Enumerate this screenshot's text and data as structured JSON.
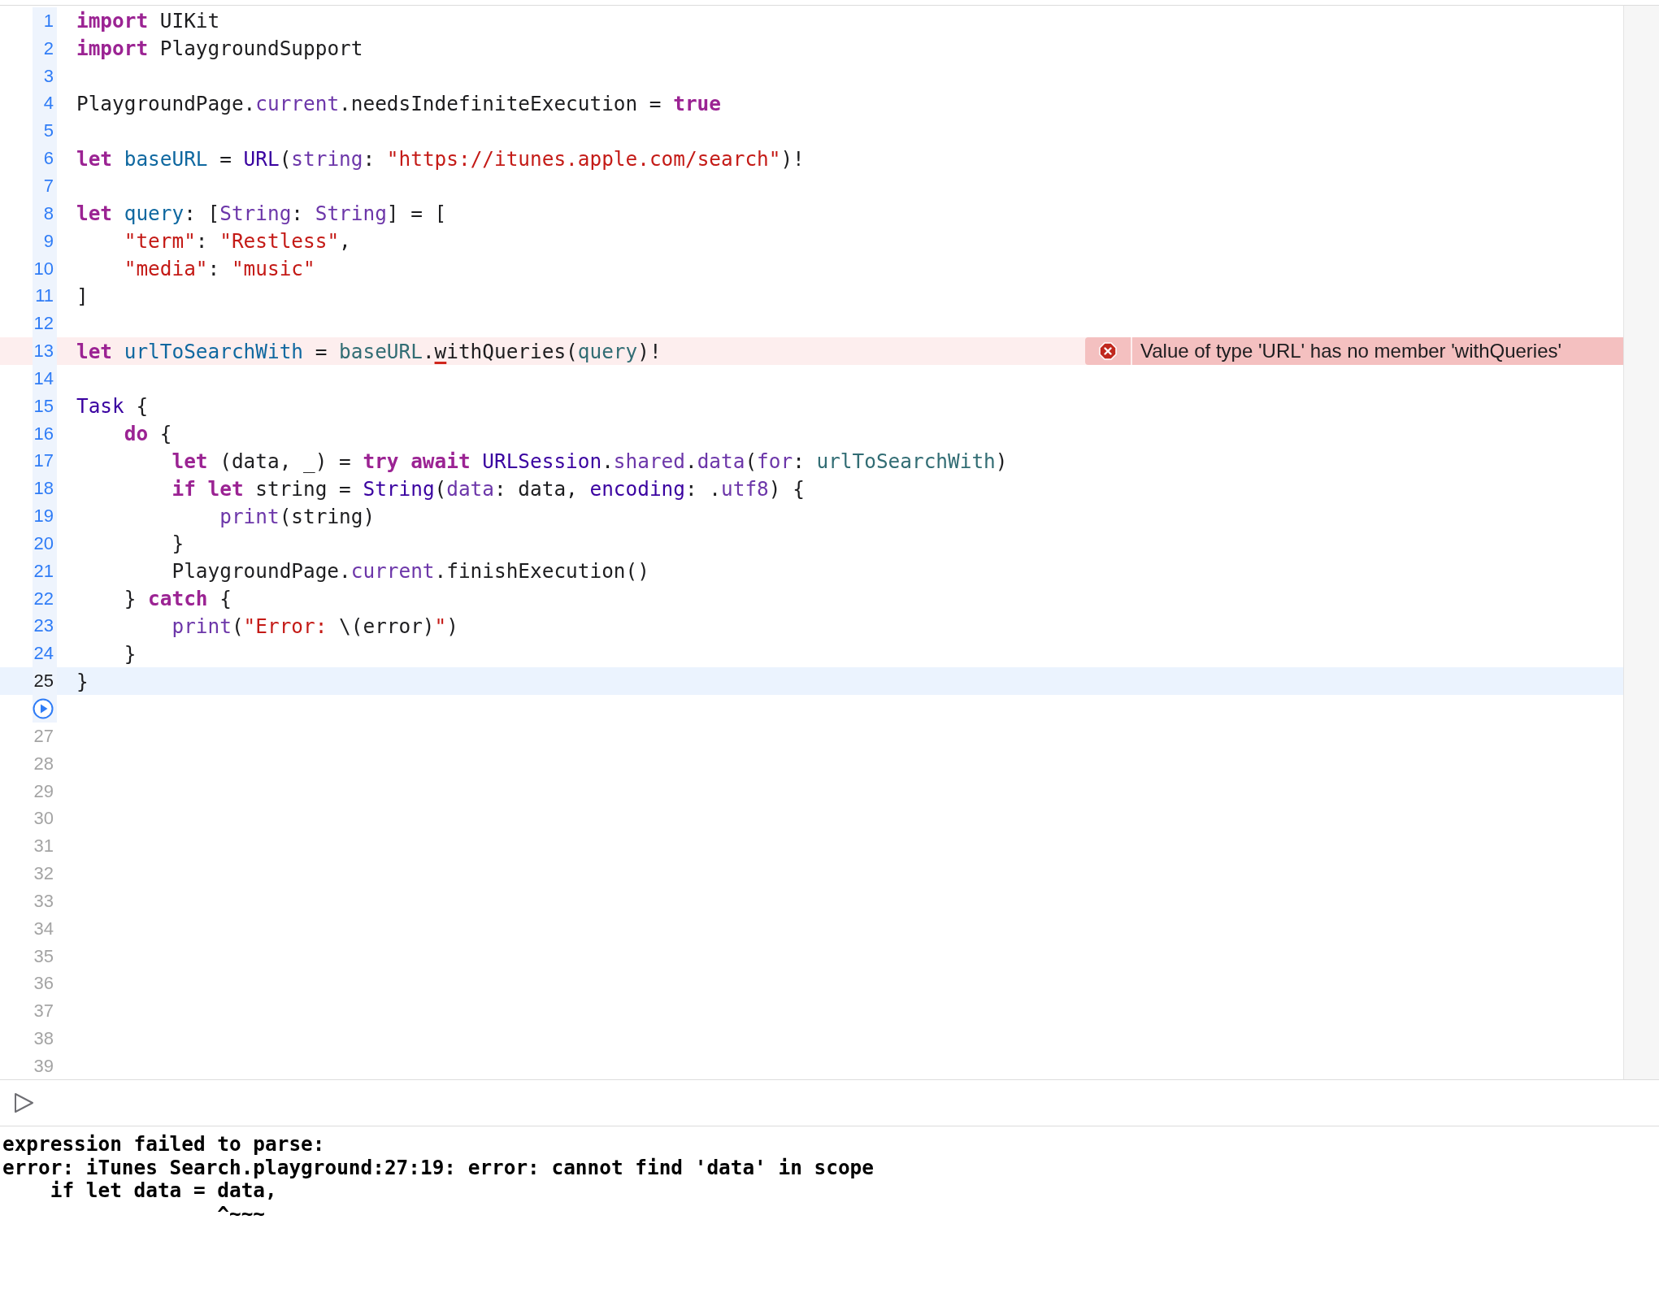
{
  "editor": {
    "lines": [
      {
        "number": "1",
        "kind": "code",
        "current": false,
        "tokens": [
          {
            "text": "import",
            "kind": "keyword"
          },
          {
            "text": " UIKit",
            "kind": "plain"
          }
        ]
      },
      {
        "number": "2",
        "kind": "code",
        "current": false,
        "tokens": [
          {
            "text": "import",
            "kind": "keyword"
          },
          {
            "text": " PlaygroundSupport",
            "kind": "plain"
          }
        ]
      },
      {
        "number": "3",
        "kind": "code",
        "current": false
      },
      {
        "number": "4",
        "kind": "code",
        "current": false,
        "tokens": [
          {
            "text": "PlaygroundPage.",
            "kind": "plain"
          },
          {
            "text": "current",
            "kind": "member"
          },
          {
            "text": ".needsIndefiniteExecution = ",
            "kind": "plain"
          },
          {
            "text": "true",
            "kind": "keyword"
          }
        ]
      },
      {
        "number": "5",
        "kind": "code",
        "current": false
      },
      {
        "number": "6",
        "kind": "code",
        "current": false,
        "tokens": [
          {
            "text": "let",
            "kind": "keyword"
          },
          {
            "text": " baseURL",
            "kind": "decl"
          },
          {
            "text": " = ",
            "kind": "plain"
          },
          {
            "text": "URL",
            "kind": "type"
          },
          {
            "text": "(",
            "kind": "plain"
          },
          {
            "text": "string",
            "kind": "member"
          },
          {
            "text": ": ",
            "kind": "plain"
          },
          {
            "text": "\"https://itunes.apple.com/search\"",
            "kind": "string"
          },
          {
            "text": ")!",
            "kind": "plain"
          }
        ]
      },
      {
        "number": "7",
        "kind": "code",
        "current": false
      },
      {
        "number": "8",
        "kind": "code",
        "current": false,
        "tokens": [
          {
            "text": "let",
            "kind": "keyword"
          },
          {
            "text": " query",
            "kind": "decl"
          },
          {
            "text": ": [",
            "kind": "plain"
          },
          {
            "text": "String",
            "kind": "member"
          },
          {
            "text": ": ",
            "kind": "plain"
          },
          {
            "text": "String",
            "kind": "member"
          },
          {
            "text": "] = [",
            "kind": "plain"
          }
        ]
      },
      {
        "number": "9",
        "kind": "code",
        "current": false,
        "tokens": [
          {
            "text": "    \"term\"",
            "kind": "string"
          },
          {
            "text": ": ",
            "kind": "plain"
          },
          {
            "text": "\"Restless\"",
            "kind": "string"
          },
          {
            "text": ",",
            "kind": "plain"
          }
        ]
      },
      {
        "number": "10",
        "kind": "code",
        "current": false,
        "tokens": [
          {
            "text": "    \"media\"",
            "kind": "string"
          },
          {
            "text": ": ",
            "kind": "plain"
          },
          {
            "text": "\"music\"",
            "kind": "string"
          }
        ]
      },
      {
        "number": "11",
        "kind": "code",
        "current": false,
        "tokens": [
          {
            "text": "]",
            "kind": "plain"
          }
        ]
      },
      {
        "number": "12",
        "kind": "code",
        "current": false
      },
      {
        "number": "13",
        "kind": "code",
        "current": false,
        "error": "Value of type 'URL' has no member 'withQueries'",
        "tokens": [
          {
            "text": "let",
            "kind": "keyword"
          },
          {
            "text": " urlToSearchWith",
            "kind": "decl"
          },
          {
            "text": " = ",
            "kind": "plain"
          },
          {
            "text": "baseURL",
            "kind": "project"
          },
          {
            "text": ".",
            "kind": "plain"
          },
          {
            "text": "w",
            "kind": "plain",
            "underlined": true
          },
          {
            "text": "ithQueries(",
            "kind": "plain"
          },
          {
            "text": "query",
            "kind": "project"
          },
          {
            "text": ")!",
            "kind": "plain"
          }
        ]
      },
      {
        "number": "14",
        "kind": "code",
        "current": false
      },
      {
        "number": "15",
        "kind": "code",
        "current": false,
        "tokens": [
          {
            "text": "Task",
            "kind": "type"
          },
          {
            "text": " {",
            "kind": "plain"
          }
        ]
      },
      {
        "number": "16",
        "kind": "code",
        "current": false,
        "tokens": [
          {
            "text": "    do",
            "kind": "keyword"
          },
          {
            "text": " {",
            "kind": "plain"
          }
        ]
      },
      {
        "number": "17",
        "kind": "code",
        "current": false,
        "tokens": [
          {
            "text": "        let",
            "kind": "keyword"
          },
          {
            "text": " (data, _) = ",
            "kind": "plain"
          },
          {
            "text": "try await",
            "kind": "keyword"
          },
          {
            "text": " URLSession",
            "kind": "type"
          },
          {
            "text": ".",
            "kind": "plain"
          },
          {
            "text": "shared",
            "kind": "member"
          },
          {
            "text": ".",
            "kind": "plain"
          },
          {
            "text": "data",
            "kind": "member"
          },
          {
            "text": "(",
            "kind": "plain"
          },
          {
            "text": "for",
            "kind": "member"
          },
          {
            "text": ": ",
            "kind": "plain"
          },
          {
            "text": "urlToSearchWith",
            "kind": "project"
          },
          {
            "text": ")",
            "kind": "plain"
          }
        ]
      },
      {
        "number": "18",
        "kind": "code",
        "current": false,
        "tokens": [
          {
            "text": "        if let",
            "kind": "keyword"
          },
          {
            "text": " string = ",
            "kind": "plain"
          },
          {
            "text": "String",
            "kind": "type"
          },
          {
            "text": "(",
            "kind": "plain"
          },
          {
            "text": "data",
            "kind": "member"
          },
          {
            "text": ": data, ",
            "kind": "plain"
          },
          {
            "text": "encoding",
            "kind": "type"
          },
          {
            "text": ": .",
            "kind": "plain"
          },
          {
            "text": "utf8",
            "kind": "member"
          },
          {
            "text": ") {",
            "kind": "plain"
          }
        ]
      },
      {
        "number": "19",
        "kind": "code",
        "current": false,
        "tokens": [
          {
            "text": "            print",
            "kind": "member"
          },
          {
            "text": "(string)",
            "kind": "plain"
          }
        ]
      },
      {
        "number": "20",
        "kind": "code",
        "current": false,
        "tokens": [
          {
            "text": "        }",
            "kind": "plain"
          }
        ]
      },
      {
        "number": "21",
        "kind": "code",
        "current": false,
        "tokens": [
          {
            "text": "        PlaygroundPage.",
            "kind": "plain"
          },
          {
            "text": "current",
            "kind": "member"
          },
          {
            "text": ".finishExecution()",
            "kind": "plain"
          }
        ]
      },
      {
        "number": "22",
        "kind": "code",
        "current": false,
        "tokens": [
          {
            "text": "    } ",
            "kind": "plain"
          },
          {
            "text": "catch",
            "kind": "keyword"
          },
          {
            "text": " {",
            "kind": "plain"
          }
        ]
      },
      {
        "number": "23",
        "kind": "code",
        "current": false,
        "tokens": [
          {
            "text": "        print",
            "kind": "member"
          },
          {
            "text": "(",
            "kind": "plain"
          },
          {
            "text": "\"Error: ",
            "kind": "string"
          },
          {
            "text": "\\(error)",
            "kind": "plain"
          },
          {
            "text": "\"",
            "kind": "string"
          },
          {
            "text": ")",
            "kind": "plain"
          }
        ]
      },
      {
        "number": "24",
        "kind": "code",
        "current": false,
        "tokens": [
          {
            "text": "    }",
            "kind": "plain"
          }
        ]
      },
      {
        "number": "25",
        "kind": "code",
        "current": true,
        "tokens": [
          {
            "text": "}",
            "kind": "plain"
          }
        ]
      },
      {
        "kind": "run",
        "current": false
      },
      {
        "number": "27",
        "kind": "blank",
        "current": false
      },
      {
        "number": "28",
        "kind": "blank",
        "current": false
      },
      {
        "number": "29",
        "kind": "blank",
        "current": false
      },
      {
        "number": "30",
        "kind": "blank",
        "current": false
      },
      {
        "number": "31",
        "kind": "blank",
        "current": false
      },
      {
        "number": "32",
        "kind": "blank",
        "current": false
      },
      {
        "number": "33",
        "kind": "blank",
        "current": false
      },
      {
        "number": "34",
        "kind": "blank",
        "current": false
      },
      {
        "number": "35",
        "kind": "blank",
        "current": false
      },
      {
        "number": "36",
        "kind": "blank",
        "current": false
      },
      {
        "number": "37",
        "kind": "blank",
        "current": false
      },
      {
        "number": "38",
        "kind": "blank",
        "current": false
      },
      {
        "number": "39",
        "kind": "blank",
        "current": false
      }
    ]
  },
  "console": {
    "lines": [
      "expression failed to parse:",
      "error: iTunes Search.playground:27:19: error: cannot find 'data' in scope",
      "    if let data = data,",
      "                  ^~~~"
    ]
  }
}
